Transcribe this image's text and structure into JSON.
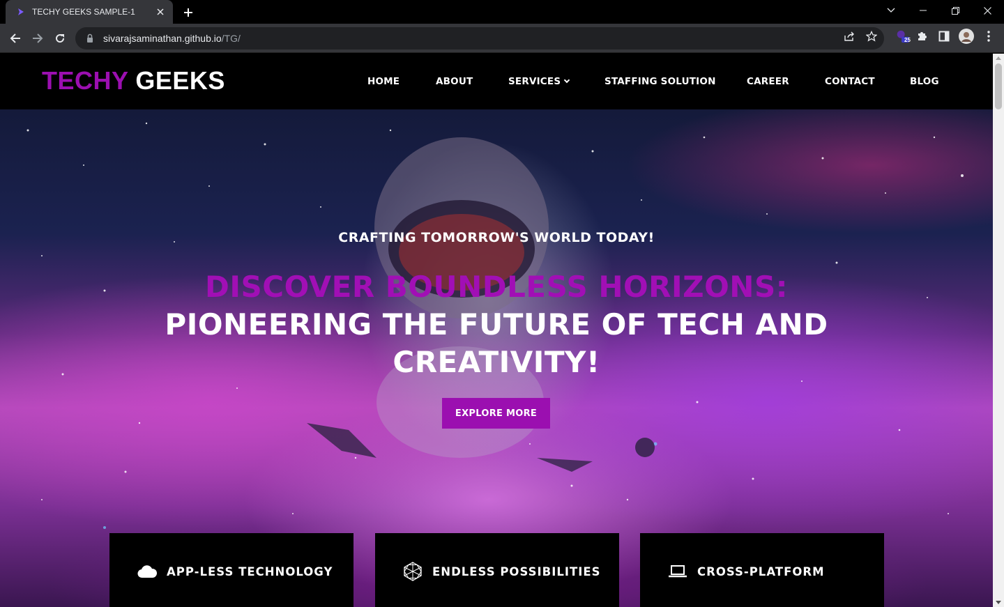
{
  "browser": {
    "tab_title": "TECHY GEEKS SAMPLE-1",
    "url_host": "sivarajsaminathan.github.io",
    "url_path": "/TG/",
    "extension_badge": "25"
  },
  "site": {
    "logo_part1": "TECHY",
    "logo_part2": "GEEKS",
    "nav": [
      "HOME",
      "ABOUT",
      "SERVICES",
      "STAFFING SOLUTION",
      "CAREER",
      "CONTACT",
      "BLOG"
    ]
  },
  "hero": {
    "subtitle": "CRAFTING TOMORROW'S WORLD TODAY!",
    "headline_accent": "DISCOVER BOUNDLESS HORIZONS:",
    "headline_main": "PIONEERING THE FUTURE OF TECH AND CREATIVITY!",
    "cta_label": "EXPLORE MORE"
  },
  "features": [
    {
      "label": "APP-LESS TECHNOLOGY",
      "icon": "cloud-icon"
    },
    {
      "label": "ENDLESS POSSIBILITIES",
      "icon": "geodesic-icon"
    },
    {
      "label": "CROSS-PLATFORM",
      "icon": "laptop-icon"
    }
  ],
  "colors": {
    "brand_purple": "#9b0fb0",
    "header_bg": "#000000",
    "chrome_bg": "#35363a"
  }
}
